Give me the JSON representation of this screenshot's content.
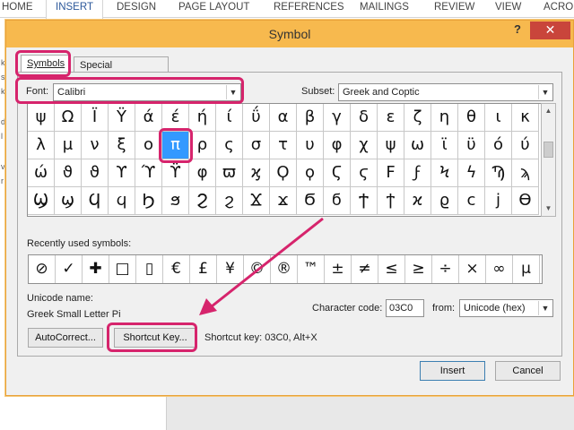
{
  "ribbon": {
    "tabs": [
      "HOME",
      "INSERT",
      "DESIGN",
      "PAGE LAYOUT",
      "REFERENCES",
      "MAILINGS",
      "REVIEW",
      "VIEW",
      "ACRO"
    ]
  },
  "doc": {
    "fragments": [
      "k",
      "s",
      "k",
      "d",
      "l",
      "v",
      "r"
    ]
  },
  "dialog": {
    "title": "Symbol",
    "help": "?",
    "close": "✕",
    "tabs": {
      "symbols": "Symbols",
      "special": "Special Characters"
    },
    "font": {
      "label": "Font:",
      "value": "Calibri"
    },
    "subset": {
      "label": "Subset:",
      "value": "Greek and Coptic"
    },
    "grid": {
      "rows": [
        [
          "ψ",
          "Ω",
          "Ϊ",
          "Ϋ",
          "ά",
          "έ",
          "ή",
          "ί",
          "ΰ",
          "α",
          "β",
          "γ",
          "δ",
          "ε",
          "ζ",
          "η",
          "θ",
          "ι",
          "κ"
        ],
        [
          "λ",
          "μ",
          "ν",
          "ξ",
          "ο",
          "π",
          "ρ",
          "ς",
          "σ",
          "τ",
          "υ",
          "φ",
          "χ",
          "ψ",
          "ω",
          "ϊ",
          "ϋ",
          "ό",
          "ύ"
        ],
        [
          "ώ",
          "ϑ",
          "ϑ",
          "ϒ",
          "ϓ",
          "ϔ",
          "φ",
          "ϖ",
          "ϗ",
          "Ϙ",
          "ϙ",
          "Ϛ",
          "ϛ",
          "Ϝ",
          "ϝ",
          "Ϟ",
          "ϟ",
          "Ϡ",
          "ϡ"
        ],
        [
          "Ϣ",
          "ϣ",
          "Ϥ",
          "ϥ",
          "Ϧ",
          "ϧ",
          "Ϩ",
          "ϩ",
          "Ϫ",
          "ϫ",
          "Ϭ",
          "ϭ",
          "Ϯ",
          "ϯ",
          "ϰ",
          "ϱ",
          "ϲ",
          "ϳ",
          "ϴ"
        ]
      ],
      "selected": "π"
    },
    "recent": {
      "label": "Recently used symbols:",
      "symbols": [
        "⊘",
        "✓",
        "✚",
        "□",
        "▯",
        "€",
        "£",
        "¥",
        "©",
        "®",
        "™",
        "±",
        "≠",
        "≤",
        "≥",
        "÷",
        "×",
        "∞",
        "µ"
      ]
    },
    "unicode_name": {
      "label": "Unicode name:",
      "value": "Greek Small Letter Pi"
    },
    "char_code": {
      "label": "Character code:",
      "value": "03C0"
    },
    "from": {
      "label": "from:",
      "value": "Unicode (hex)"
    },
    "buttons": {
      "autocorrect": "AutoCorrect...",
      "shortcut_key": "Shortcut Key...",
      "insert": "Insert",
      "cancel": "Cancel"
    },
    "shortcut_text": "Shortcut key: 03C0, Alt+X"
  },
  "colors": {
    "titlebar": "#f7b94e",
    "highlight": "#d6246c",
    "selection": "#3399ff"
  }
}
